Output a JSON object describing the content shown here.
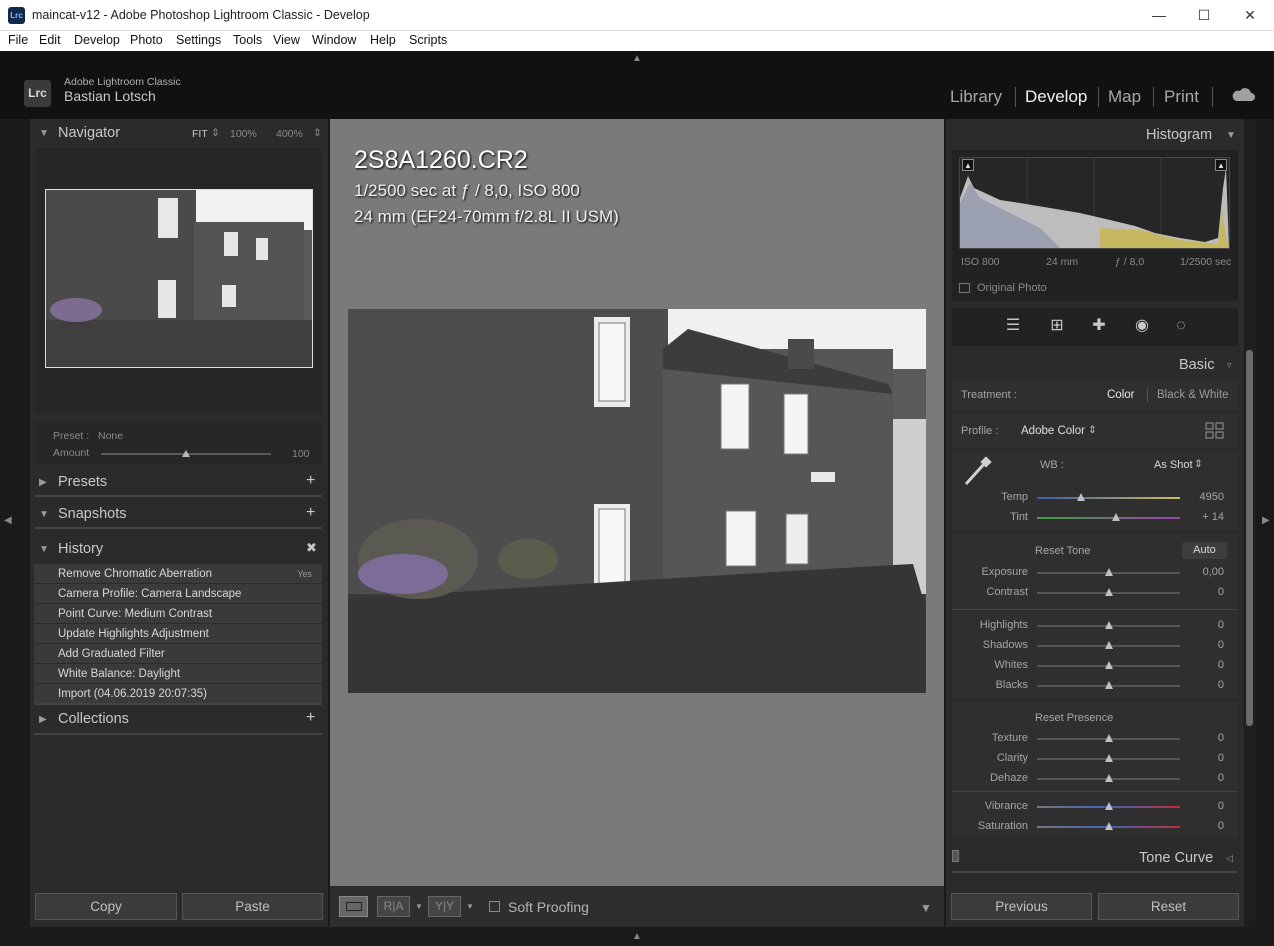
{
  "window": {
    "title": "maincat-v12 - Adobe Photoshop Lightroom Classic - Develop",
    "app_icon": "Lrc"
  },
  "menu": [
    "File",
    "Edit",
    "Develop",
    "Photo",
    "Settings",
    "Tools",
    "View",
    "Window",
    "Help",
    "Scripts"
  ],
  "identity": {
    "badge": "Lrc",
    "product": "Adobe Lightroom Classic",
    "user": "Bastian Lotsch"
  },
  "modules": [
    "Library",
    "Develop",
    "Map",
    "Print"
  ],
  "active_module": "Develop",
  "navigator": {
    "title": "Navigator",
    "zoom": [
      "FIT",
      "100%",
      "400%"
    ],
    "preset_label": "Preset :",
    "preset_value": "None",
    "amount_label": "Amount",
    "amount_value": "100",
    "amount_fraction": 0.5
  },
  "left_panels": {
    "presets": "Presets",
    "snapshots": "Snapshots",
    "history": "History",
    "collections": "Collections"
  },
  "history": [
    {
      "label": "Remove Chromatic Aberration",
      "value": "Yes"
    },
    {
      "label": "Camera Profile: Camera Landscape",
      "value": ""
    },
    {
      "label": "Point Curve: Medium Contrast",
      "value": ""
    },
    {
      "label": "Update Highlights Adjustment",
      "value": ""
    },
    {
      "label": "Add Graduated Filter",
      "value": ""
    },
    {
      "label": "White Balance: Daylight",
      "value": ""
    },
    {
      "label": "Import (04.06.2019 20:07:35)",
      "value": ""
    }
  ],
  "left_buttons": {
    "copy": "Copy",
    "paste": "Paste"
  },
  "photo_info": {
    "filename": "2S8A1260.CR2",
    "exposure": "1/2500 sec at ƒ / 8,0, ISO 800",
    "lens": "24 mm (EF24-70mm f/2.8L II USM)"
  },
  "toolbar": {
    "soft_proofing": "Soft Proofing"
  },
  "histogram": {
    "title": "Histogram",
    "iso": "ISO 800",
    "focal": "24 mm",
    "aperture": "ƒ / 8,0",
    "shutter": "1/2500 sec",
    "original_photo": "Original Photo"
  },
  "basic": {
    "title": "Basic",
    "treatment_label": "Treatment :",
    "treatment_color": "Color",
    "treatment_bw": "Black & White",
    "profile_label": "Profile :",
    "profile_value": "Adobe Color",
    "wb_label": "WB :",
    "wb_value": "As Shot",
    "reset_tone": "Reset Tone",
    "auto": "Auto",
    "reset_presence": "Reset Presence",
    "sliders": [
      {
        "label": "Temp",
        "value": "4950",
        "pos": 0.31
      },
      {
        "label": "Tint",
        "value": "+ 14",
        "pos": 0.55
      },
      {
        "label": "Exposure",
        "value": "0,00",
        "pos": 0.5
      },
      {
        "label": "Contrast",
        "value": "0",
        "pos": 0.5
      },
      {
        "label": "Highlights",
        "value": "0",
        "pos": 0.5
      },
      {
        "label": "Shadows",
        "value": "0",
        "pos": 0.5
      },
      {
        "label": "Whites",
        "value": "0",
        "pos": 0.5
      },
      {
        "label": "Blacks",
        "value": "0",
        "pos": 0.5
      },
      {
        "label": "Texture",
        "value": "0",
        "pos": 0.5
      },
      {
        "label": "Clarity",
        "value": "0",
        "pos": 0.5
      },
      {
        "label": "Dehaze",
        "value": "0",
        "pos": 0.5
      },
      {
        "label": "Vibrance",
        "value": "0",
        "pos": 0.5
      },
      {
        "label": "Saturation",
        "value": "0",
        "pos": 0.5
      }
    ]
  },
  "tone_curve": {
    "title": "Tone Curve"
  },
  "right_buttons": {
    "previous": "Previous",
    "reset": "Reset"
  }
}
